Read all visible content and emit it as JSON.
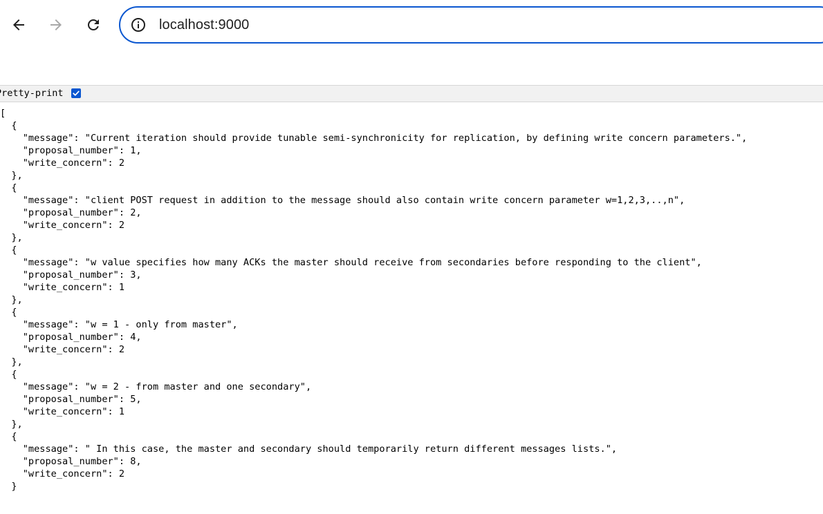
{
  "browser": {
    "url": "localhost:9000"
  },
  "pretty_print": {
    "label": "Pretty-print",
    "checked": true
  },
  "json": {
    "lines": [
      "[",
      "  {",
      "    \"message\": \"Current iteration should provide tunable semi-synchronicity for replication, by defining write concern parameters.\",",
      "    \"proposal_number\": 1,",
      "    \"write_concern\": 2",
      "  },",
      "  {",
      "    \"message\": \"client POST request in addition to the message should also contain write concern parameter w=1,2,3,..,n\",",
      "    \"proposal_number\": 2,",
      "    \"write_concern\": 2",
      "  },",
      "  {",
      "    \"message\": \"w value specifies how many ACKs the master should receive from secondaries before responding to the client\",",
      "    \"proposal_number\": 3,",
      "    \"write_concern\": 1",
      "  },",
      "  {",
      "    \"message\": \"w = 1 - only from master\",",
      "    \"proposal_number\": 4,",
      "    \"write_concern\": 2",
      "  },",
      "  {",
      "    \"message\": \"w = 2 - from master and one secondary\",",
      "    \"proposal_number\": 5,",
      "    \"write_concern\": 1",
      "  },",
      "  {",
      "    \"message\": \" In this case, the master and secondary should temporarily return different messages lists.\",",
      "    \"proposal_number\": 8,",
      "    \"write_concern\": 2",
      "  }"
    ]
  }
}
